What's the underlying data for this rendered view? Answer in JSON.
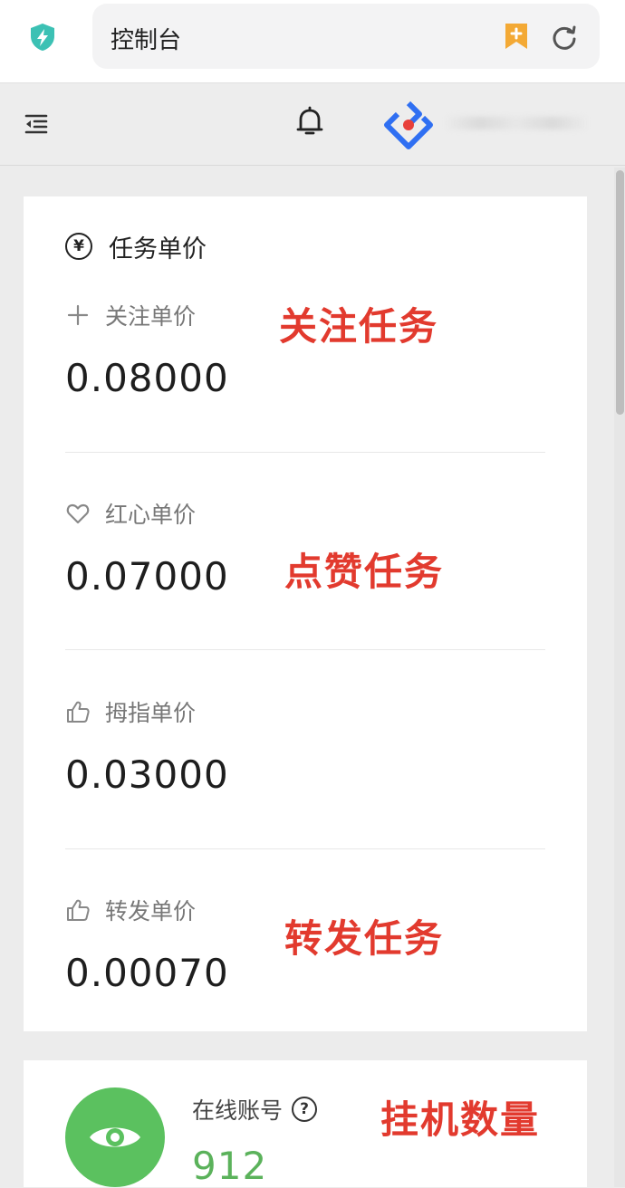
{
  "browser": {
    "address_text": "控制台",
    "icons": [
      "shield-bolt-icon",
      "bookmark-add-icon",
      "reload-icon"
    ]
  },
  "header": {
    "icons": [
      "menu-collapse-icon",
      "bell-icon",
      "app-logo-icon"
    ]
  },
  "price_card": {
    "title": "任务单价",
    "title_icon": "yen-icon",
    "items": [
      {
        "icon": "plus-icon",
        "label": "关注单价",
        "value": "0.08000",
        "annotation": "关注任务"
      },
      {
        "icon": "heart-icon",
        "label": "红心单价",
        "value": "0.07000",
        "annotation": "点赞任务"
      },
      {
        "icon": "thumbs-up-icon",
        "label": "拇指单价",
        "value": "0.03000",
        "annotation": ""
      },
      {
        "icon": "thumbs-up-icon",
        "label": "转发单价",
        "value": "0.00070",
        "annotation": "转发任务"
      }
    ]
  },
  "online_card": {
    "label": "在线账号",
    "value": "912",
    "annotation": "挂机数量",
    "icon": "eye-icon",
    "help_icon": "question-icon"
  },
  "colors": {
    "annotation_red": "#e23a2e",
    "online_green": "#5bc15f",
    "shield_teal": "#3cc1b4",
    "logo_blue": "#2f6ff2",
    "logo_red": "#e8403a",
    "bookmark_orange": "#f3a935"
  }
}
